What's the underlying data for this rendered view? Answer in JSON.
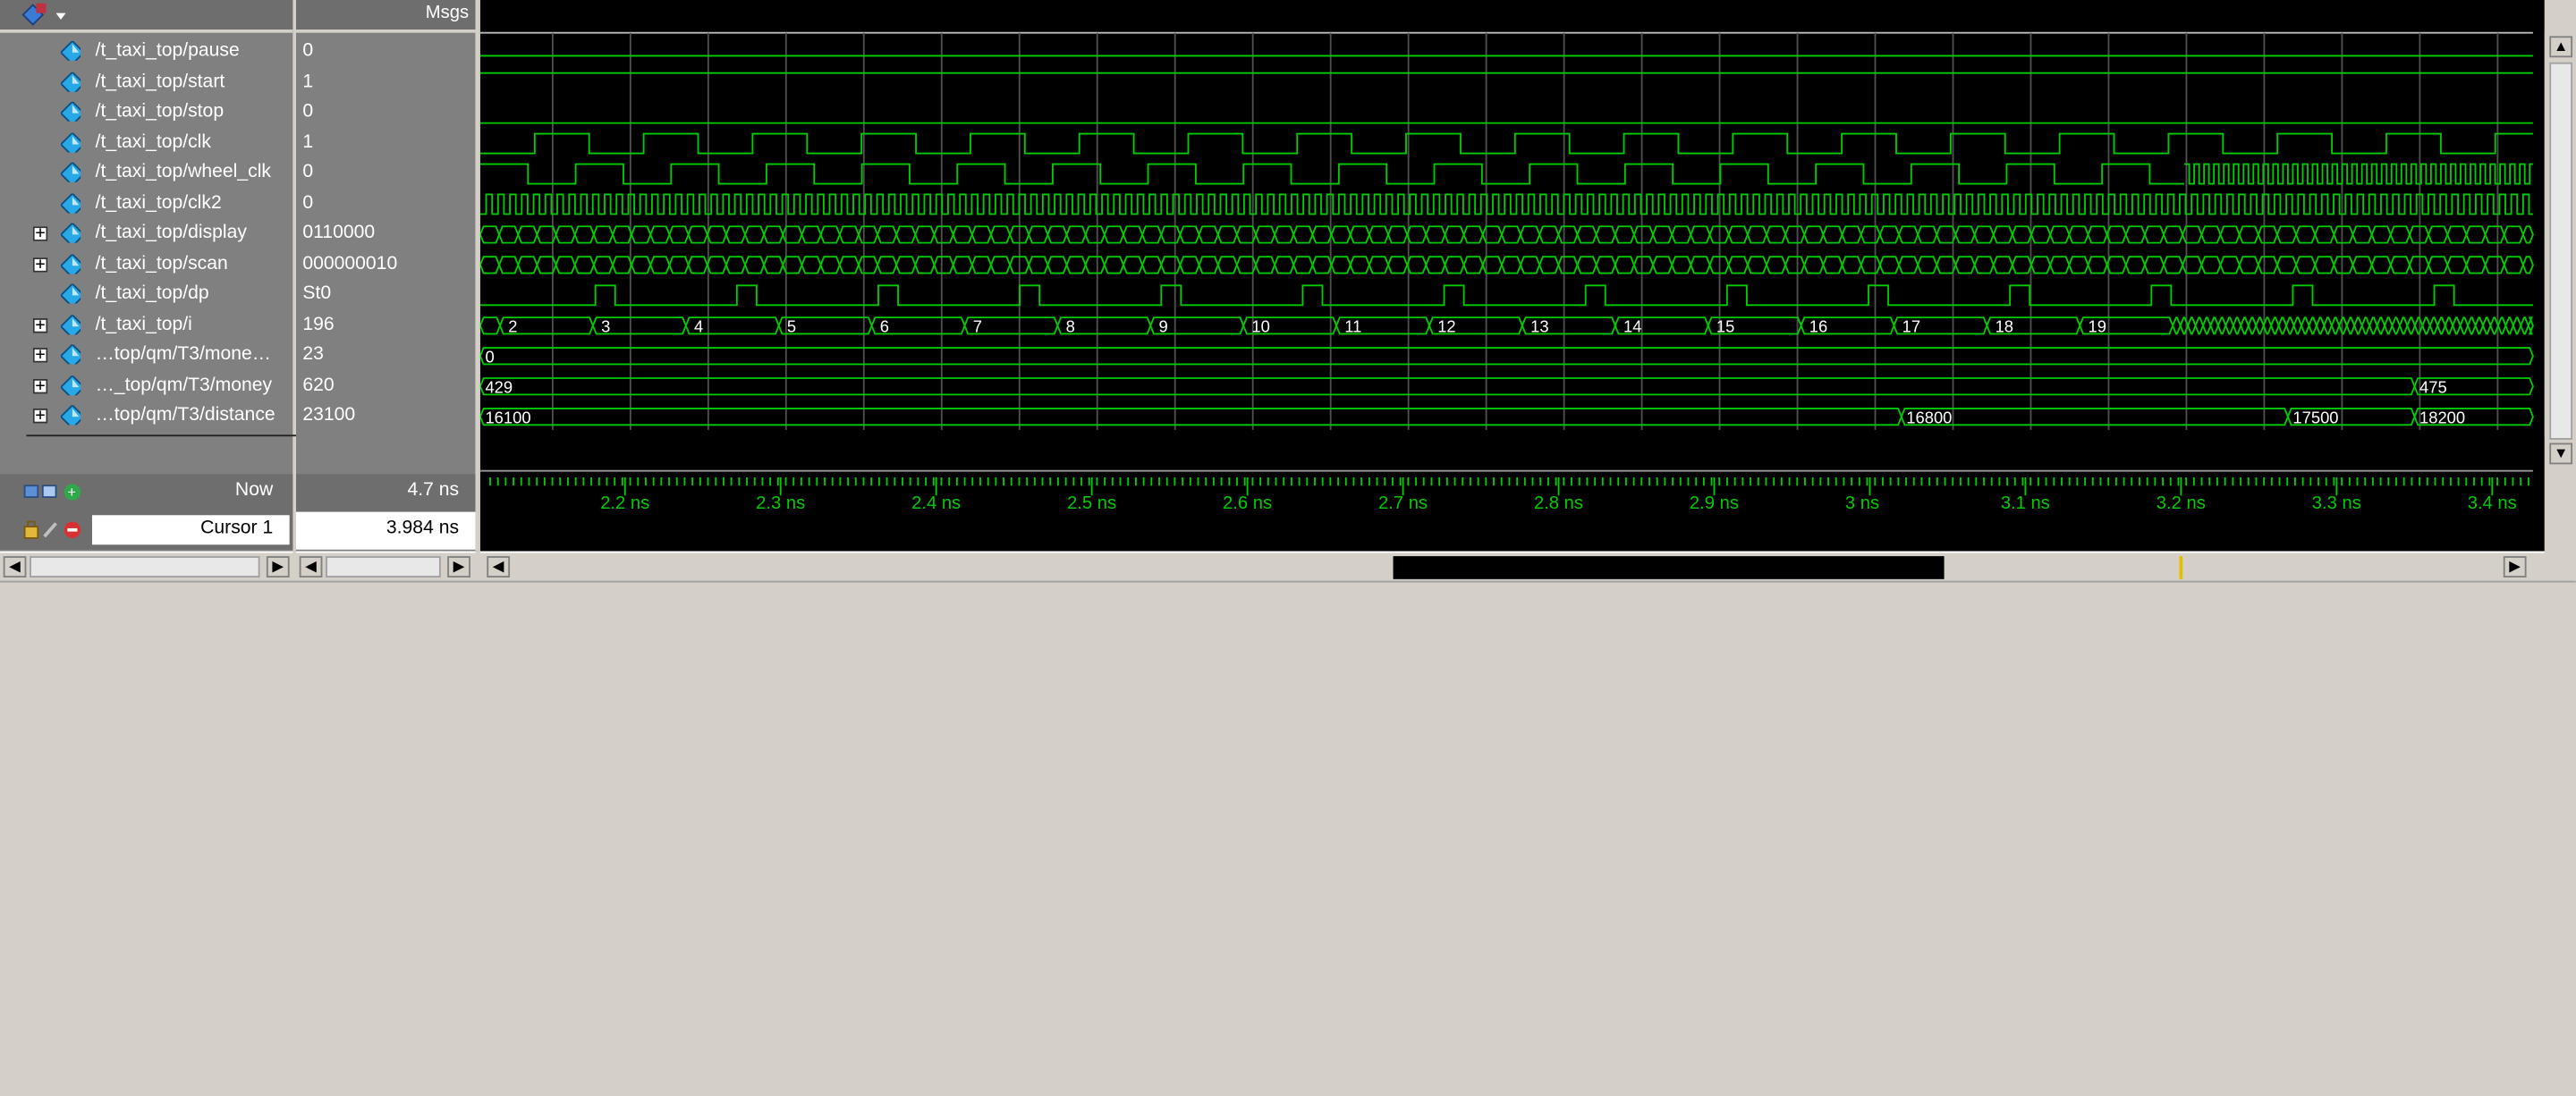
{
  "header": {
    "msgs_label": "Msgs",
    "toolbar_icon": "wave-object-icon"
  },
  "signals": [
    {
      "name": "/t_taxi_top/pause",
      "value": "0",
      "expandable": false,
      "kind": "bit"
    },
    {
      "name": "/t_taxi_top/start",
      "value": "1",
      "expandable": false,
      "kind": "bit"
    },
    {
      "name": "/t_taxi_top/stop",
      "value": "0",
      "expandable": false,
      "kind": "bit"
    },
    {
      "name": "/t_taxi_top/clk",
      "value": "1",
      "expandable": false,
      "kind": "bit"
    },
    {
      "name": "/t_taxi_top/wheel_clk",
      "value": "0",
      "expandable": false,
      "kind": "bit"
    },
    {
      "name": "/t_taxi_top/clk2",
      "value": "0",
      "expandable": false,
      "kind": "bit"
    },
    {
      "name": "/t_taxi_top/display",
      "value": "0110000",
      "expandable": true,
      "kind": "bus"
    },
    {
      "name": "/t_taxi_top/scan",
      "value": "000000010",
      "expandable": true,
      "kind": "bus"
    },
    {
      "name": "/t_taxi_top/dp",
      "value": "St0",
      "expandable": false,
      "kind": "bit"
    },
    {
      "name": "/t_taxi_top/i",
      "value": "196",
      "expandable": true,
      "kind": "bus"
    },
    {
      "name": "…top/qm/T3/mone…",
      "value": "23",
      "expandable": true,
      "kind": "bus"
    },
    {
      "name": "…_top/qm/T3/money",
      "value": "620",
      "expandable": true,
      "kind": "bus"
    },
    {
      "name": "…top/qm/T3/distance",
      "value": "23100",
      "expandable": true,
      "kind": "bus"
    }
  ],
  "bus_labels": {
    "i": [
      "2",
      "3",
      "4",
      "5",
      "6",
      "7",
      "8",
      "9",
      "10",
      "11",
      "12",
      "13",
      "14",
      "15",
      "16",
      "17",
      "18",
      "19"
    ],
    "mone": [
      "0"
    ],
    "money": [
      "429",
      "475"
    ],
    "distance": [
      "16100",
      "16800",
      "17500",
      "18200"
    ]
  },
  "footer": {
    "now_label": "Now",
    "now_value": "4.7 ns",
    "cursor_label": "Cursor 1",
    "cursor_value": "3.984 ns"
  },
  "timeline": {
    "ticks": [
      "2.2 ns",
      "2.3 ns",
      "2.4 ns",
      "2.5 ns",
      "2.6 ns",
      "2.7 ns",
      "2.8 ns",
      "2.9 ns",
      "3 ns",
      "3.1 ns",
      "3.2 ns",
      "3.3 ns",
      "3.4 ns"
    ]
  },
  "colors": {
    "wave": "#00cc00",
    "grid": "#505050",
    "timeline_text": "#00cc00",
    "panel_bg": "#808080",
    "wave_bg": "#000000"
  }
}
